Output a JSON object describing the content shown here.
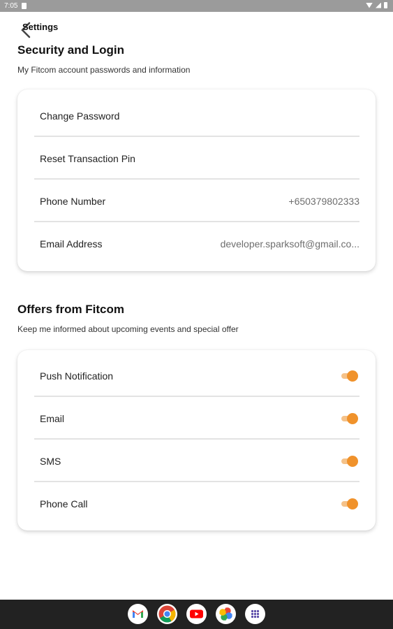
{
  "status_bar": {
    "time": "7:05"
  },
  "header": {
    "title": "Settings"
  },
  "security": {
    "title": "Security and Login",
    "subtitle": "My Fitcom account passwords and information",
    "items": [
      {
        "label": "Change Password",
        "value": ""
      },
      {
        "label": "Reset Transaction Pin",
        "value": ""
      },
      {
        "label": "Phone Number",
        "value": "+650379802333"
      },
      {
        "label": "Email Address",
        "value": "developer.sparksoft@gmail.co..."
      }
    ]
  },
  "offers": {
    "title": "Offers from Fitcom",
    "subtitle": "Keep me informed about upcoming events and special offer",
    "items": [
      {
        "label": "Push Notification",
        "enabled": true
      },
      {
        "label": "Email",
        "enabled": true
      },
      {
        "label": "SMS",
        "enabled": true
      },
      {
        "label": "Phone Call",
        "enabled": true
      }
    ]
  },
  "colors": {
    "accent": "#f0922b",
    "accent_track": "#f5c289"
  },
  "dock_apps": [
    "gmail-icon",
    "chrome-icon",
    "youtube-icon",
    "photos-icon",
    "app-drawer-icon"
  ]
}
